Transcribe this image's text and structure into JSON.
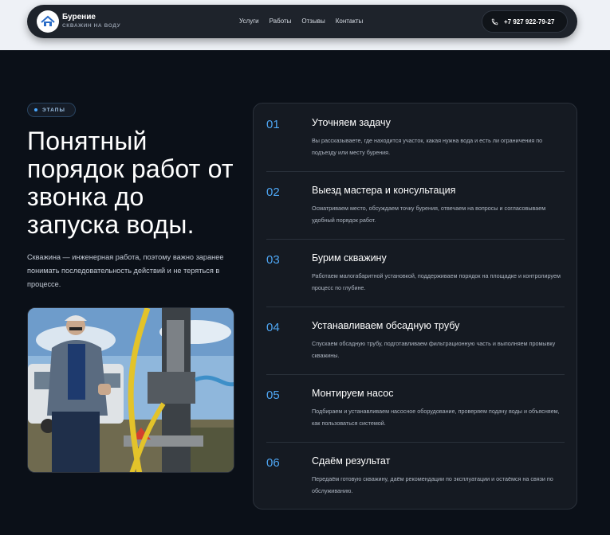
{
  "header": {
    "brand_name": "Бурение",
    "brand_sub": "СКВАЖИН НА ВОДУ",
    "menu": [
      "Услуги",
      "Работы",
      "Отзывы",
      "Контакты"
    ],
    "phone": "+7 927 922-79-27"
  },
  "hero": {
    "badge": "ЭТАПЫ",
    "headline": "Понятный порядок работ от звонка до запуска воды.",
    "lead": "Скважина — инженерная работа, поэтому важно заранее понимать последовательность действий и не теряться в процессе."
  },
  "steps": [
    {
      "num": "01",
      "title": "Уточняем задачу",
      "desc": "Вы рассказываете, где находится участок, какая нужна вода и есть ли ограничения по подъезду или месту бурения."
    },
    {
      "num": "02",
      "title": "Выезд мастера и консультация",
      "desc": "Осматриваем место, обсуждаем точку бурения, отвечаем на вопросы и согласовываем удобный порядок работ."
    },
    {
      "num": "03",
      "title": "Бурим скважину",
      "desc": "Работаем малогабаритной установкой, поддерживаем порядок на площадке и контролируем процесс по глубине."
    },
    {
      "num": "04",
      "title": "Устанавливаем обсадную трубу",
      "desc": "Спускаем обсадную трубу, подготавливаем фильтрационную часть и выполняем промывку скважины."
    },
    {
      "num": "05",
      "title": "Монтируем насос",
      "desc": "Подбираем и устанавливаем насосное оборудование, проверяем подачу воды и объясняем, как пользоваться системой."
    },
    {
      "num": "06",
      "title": "Сдаём результат",
      "desc": "Передаём готовую скважину, даём рекомендации по эксплуатации и остаёмся на связи по обслуживанию."
    }
  ],
  "colors": {
    "accent": "#4ea6f3",
    "background": "#0b1018",
    "panel": "#151a22",
    "header_band": "#eef1f6"
  },
  "icons": {
    "logo": "house-logo-icon",
    "phone": "phone-icon",
    "badge": "dot-icon"
  }
}
